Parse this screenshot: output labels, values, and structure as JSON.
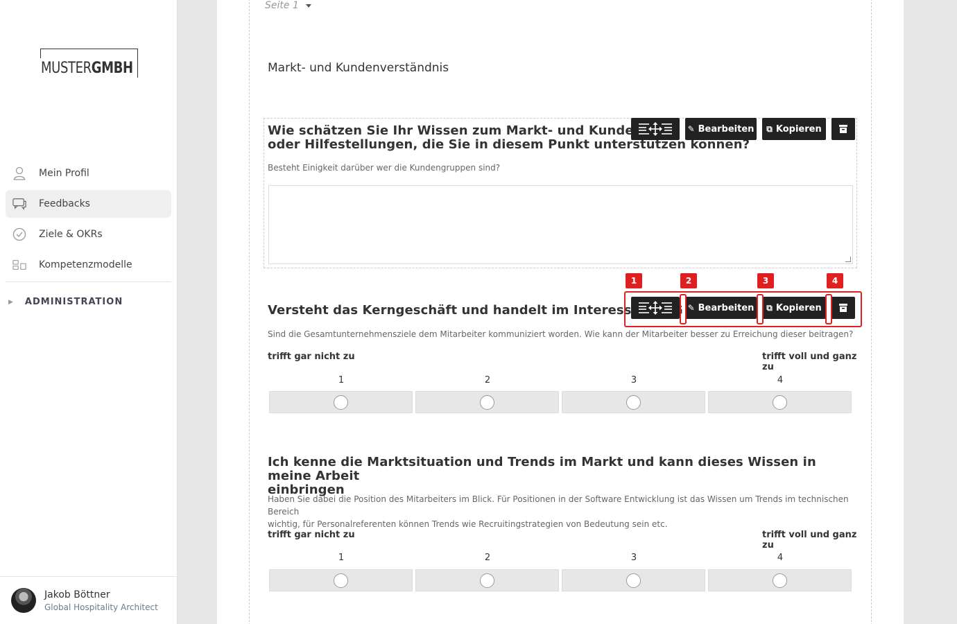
{
  "logo": {
    "part1": "MUSTER",
    "part2": "GMBH"
  },
  "sidebar": {
    "items": [
      {
        "label": "Mein Profil",
        "icon": "user-icon"
      },
      {
        "label": "Feedbacks",
        "icon": "chat-icon",
        "active": true
      },
      {
        "label": "Ziele & OKRs",
        "icon": "check-circle-icon"
      },
      {
        "label": "Kompetenzmodelle",
        "icon": "model-icon"
      }
    ],
    "admin_label": "ADMINISTRATION"
  },
  "user": {
    "name": "Jakob Böttner",
    "role": "Global Hospitality Architect"
  },
  "form": {
    "page_label": "Seite 1",
    "section_title": "Markt- und Kundenverständnis",
    "questions": [
      {
        "title_line1": "Wie schätzen Sie Ihr Wissen zum Markt- und Kundenverst",
        "title_line2": "oder Hilfestellungen, die Sie in diesem Punkt unterstützen können?",
        "description": "Besteht Einigkeit darüber wer die Kundengruppen sind?"
      },
      {
        "title": "Versteht das Kerngeschäft und handelt im Interesse der G",
        "description": "Sind die Gesamtunternehmensziele dem Mitarbeiter kommuniziert worden. Wie kann der Mitarbeiter besser zu Erreichung dieser beitragen?",
        "scale_low": "trifft gar nicht zu",
        "scale_high": "trifft voll und ganz zu",
        "scale": [
          "1",
          "2",
          "3",
          "4"
        ]
      },
      {
        "title_line1": "Ich kenne die Marktsituation und Trends im Markt und kann dieses Wissen in meine Arbeit",
        "title_line2": "einbringen",
        "description_line1": "Haben Sie dabei die Position des Mitarbeiters im Blick. Für Positionen in der Software Entwicklung ist das Wissen um Trends im technischen Bereich",
        "description_line2": "wichtig, für Personalreferenten können Trends wie Recruitingstrategien von Bedeutung sein etc.",
        "scale_low": "trifft gar nicht zu",
        "scale_high": "trifft voll und ganz zu",
        "scale": [
          "1",
          "2",
          "3",
          "4"
        ]
      }
    ]
  },
  "toolbar": {
    "edit_label": "Bearbeiten",
    "copy_label": "Kopieren"
  },
  "annotations": [
    "1",
    "2",
    "3",
    "4"
  ],
  "colors": {
    "annotation": "#e02020",
    "toolbar": "#222222"
  }
}
